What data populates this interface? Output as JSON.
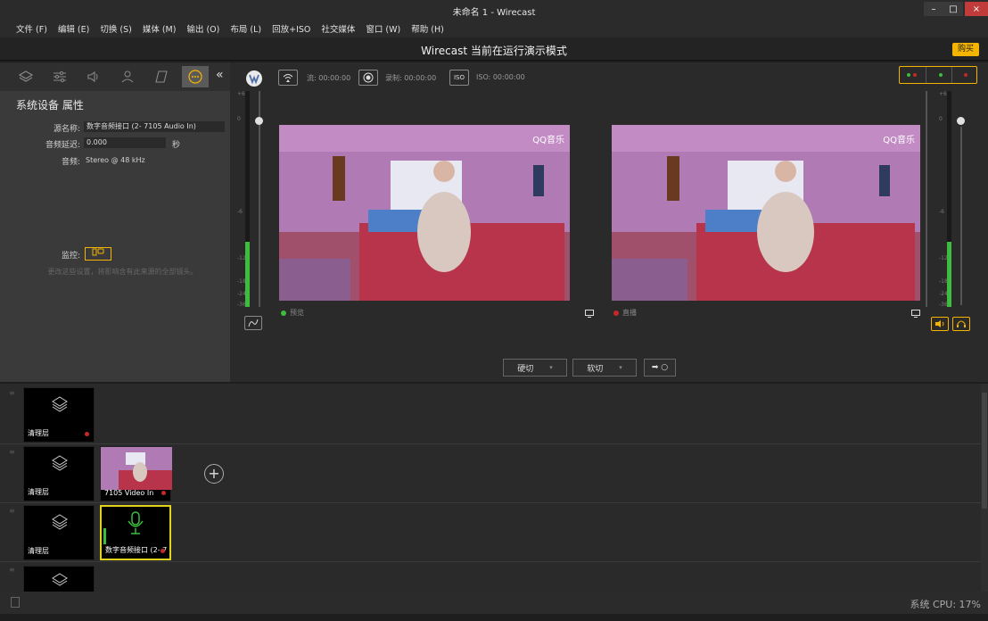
{
  "window": {
    "title": "未命名 1 - Wirecast",
    "min": "–",
    "max": "□",
    "close": "×"
  },
  "menu": [
    "文件 (F)",
    "编辑 (E)",
    "切换 (S)",
    "媒体 (M)",
    "输出 (O)",
    "布局 (L)",
    "回放+ISO",
    "社交媒体",
    "窗口 (W)",
    "帮助 (H)"
  ],
  "banner": {
    "message": "Wirecast 当前在运行演示模式",
    "buy_label": "购买"
  },
  "left_panel": {
    "title": "系统设备 属性",
    "source_name_label": "源名称:",
    "source_name_value": "数字音频接口 (2- 7105 Audio In)",
    "delay_label": "音频延迟:",
    "delay_value": "0.000",
    "delay_unit": "秒",
    "audio_label": "音频:",
    "audio_value": "Stereo @ 48 kHz",
    "monitor_label": "监控:",
    "hint": "更改这些设置，将影响含有此来源的全部镜头。",
    "collapse": "«"
  },
  "toolbar": {
    "stream_label": "流:",
    "stream_time": "00:00:00",
    "record_label": "录制:",
    "record_time": "00:00:00",
    "iso_label": "ISO:",
    "iso_time": "00:00:00",
    "iso_badge": "ISO"
  },
  "preview": {
    "label": "预览",
    "watermark": "QQ音乐"
  },
  "live": {
    "label": "直播",
    "watermark": "QQ音乐"
  },
  "vu_scale": [
    "+6",
    "0",
    "-6",
    "-12",
    "-18",
    "-24",
    "-36"
  ],
  "vu_levels": {
    "left_meter": 0.3,
    "right_meter": 0.3
  },
  "transitions": {
    "cut": "硬切",
    "smooth": "软切",
    "go": "➡ ○"
  },
  "layers": [
    {
      "shots": [
        {
          "label": "清理层"
        }
      ]
    },
    {
      "shots": [
        {
          "label": "清理层"
        },
        {
          "label": "7105 Video In"
        }
      ]
    },
    {
      "shots": [
        {
          "label": "清理层"
        },
        {
          "label": "数字音频接口 (2- 7"
        }
      ]
    },
    {
      "shots": [
        {
          "label": ""
        }
      ]
    }
  ],
  "status": {
    "cpu_label": "系统 CPU:",
    "cpu_value": "17%"
  },
  "colors": {
    "accent": "#f5b400",
    "live_red": "#c62828",
    "preview_green": "#3cbd3c"
  }
}
